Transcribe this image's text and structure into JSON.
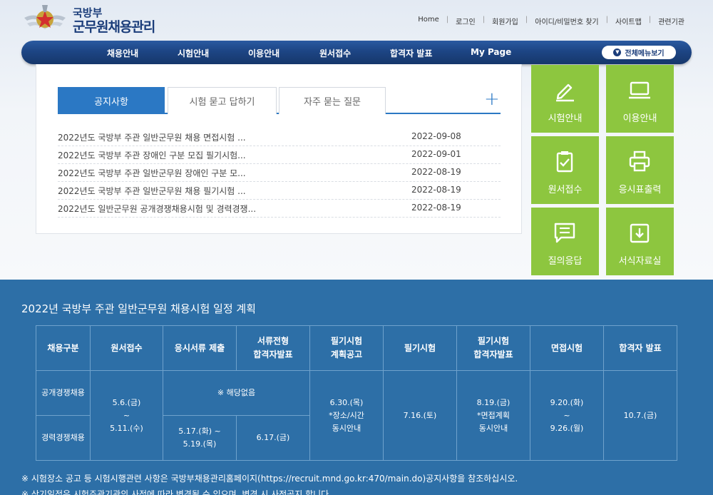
{
  "logo": {
    "sub": "국방부",
    "main": "군무원채용관리"
  },
  "utilnav": [
    "Home",
    "로그인",
    "회원가입",
    "아이디/비밀번호 찾기",
    "사이트맵",
    "관련기관"
  ],
  "gnb": {
    "items": [
      "채용안내",
      "시험안내",
      "이용안내",
      "원서접수",
      "합격자 발표",
      "My Page"
    ],
    "allmenu": "전체메뉴보기"
  },
  "tabs": [
    "공지사항",
    "시험 묻고 답하기",
    "자주 묻는 질문"
  ],
  "notices": [
    {
      "title": "2022년도 국방부 주관 일반군무원 채용 면접시험 ...",
      "date": "2022-09-08"
    },
    {
      "title": "2022년도 국방부 주관 장애인 구분 모집 필기시험...",
      "date": "2022-09-01"
    },
    {
      "title": "2022년도 국방부 주관 일반군무원 장애인 구분 모...",
      "date": "2022-08-19"
    },
    {
      "title": "2022년도 국방부 주관 일반군무원 채용 필기시험 ...",
      "date": "2022-08-19"
    },
    {
      "title": "2022년도 일반군무원 공개경쟁채용시험 및 경력경쟁...",
      "date": "2022-08-19"
    }
  ],
  "tiles": [
    {
      "label": "시험안내",
      "icon": "pencil-icon"
    },
    {
      "label": "이용안내",
      "icon": "monitor-icon"
    },
    {
      "label": "원서접수",
      "icon": "clipboard-check-icon"
    },
    {
      "label": "응시표출력",
      "icon": "printer-icon"
    },
    {
      "label": "질의응답",
      "icon": "chat-icon"
    },
    {
      "label": "서식자료실",
      "icon": "download-box-icon"
    }
  ],
  "colors": {
    "tile": "#8dc63f",
    "navy": "#1b3d7a",
    "tab_active": "#2b78c4",
    "schedule_bg": "#2d6fa7"
  },
  "schedule": {
    "title": "2022년 국방부 주관 일반군무원 채용시험 일정 계획",
    "headers": [
      "채용구분",
      "원서접수",
      "응시서류 제출",
      "서류전형\n합격자발표",
      "필기시험\n계획공고",
      "필기시험",
      "필기시험\n합격자발표",
      "면접시험",
      "합격자 발표"
    ],
    "rows": {
      "open_label": "공개경쟁채용",
      "career_label": "경력경쟁채용",
      "apply": "5.6.(금)\n~\n5.11.(수)",
      "na": "※ 해당없음",
      "docs": "5.17.(화) ~\n5.19.(목)",
      "doc_result": "6.17.(금)",
      "written_plan": "6.30.(목)\n*장소/시간\n동시안내",
      "written": "7.16.(토)",
      "written_result": "8.19.(금)\n*면접계획\n동시안내",
      "interview": "9.20.(화)\n~\n9.26.(월)",
      "final": "10.7.(금)"
    }
  },
  "footnotes": [
    "※ 시험장소 공고 등 시험시행관련 사항은 국방부채용관리홈페이지(https://recruit.mnd.go.kr:470/main.do)공지사항을 참조하십시오.",
    "※ 상기일정은 시험주관기관의 사정에 따라 변경될 수 있으며, 변경 시 사전공지 합니다."
  ]
}
